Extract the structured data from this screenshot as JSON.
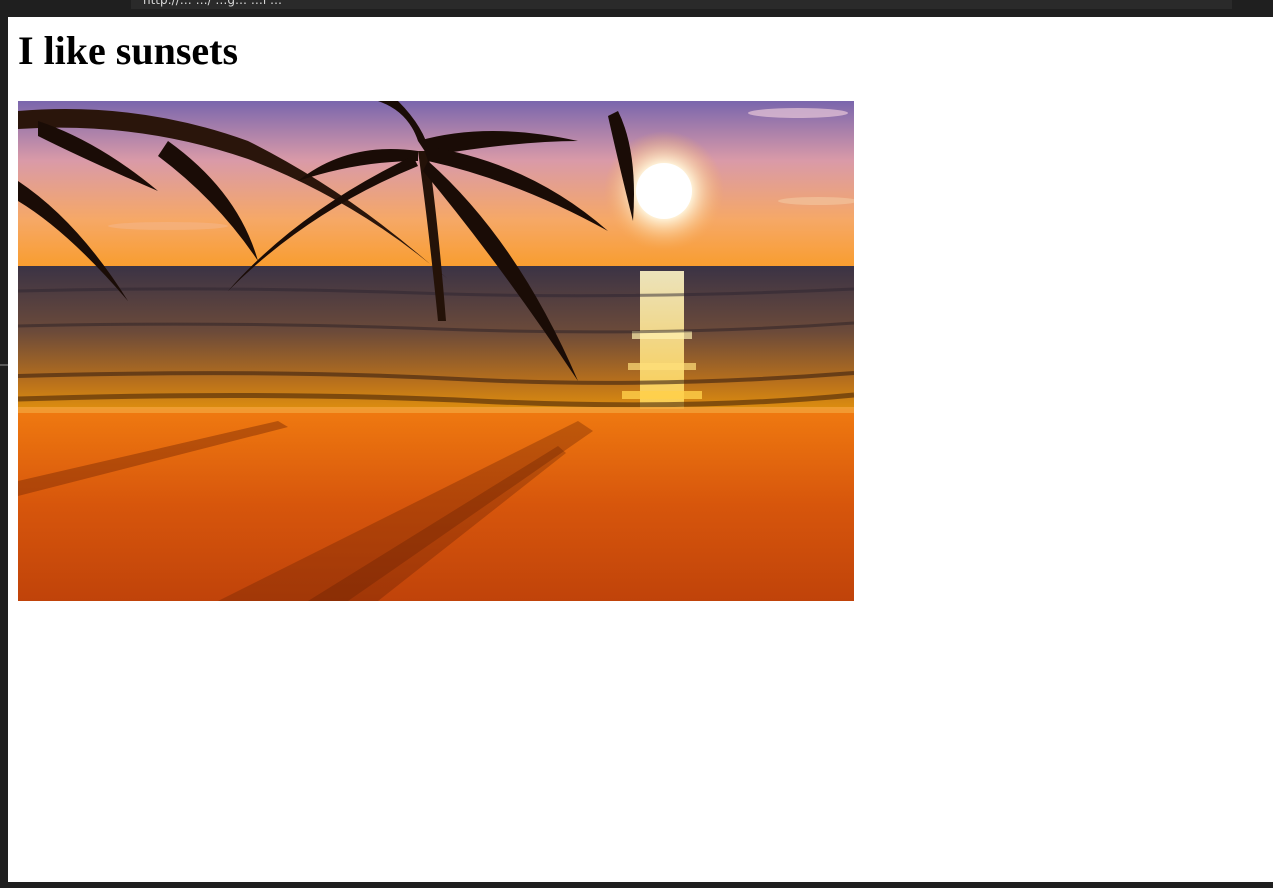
{
  "browser": {
    "address_bar_text": "http://…  …/ …g…  …l  …"
  },
  "page": {
    "heading": "I like sunsets"
  },
  "colors": {
    "chrome_background": "#1f1f1f",
    "page_background": "#ffffff",
    "heading_text": "#000000",
    "sky_top": "#8b6bb0",
    "sky_horizon": "#f7a43c",
    "sun": "#fffbe8",
    "sea": "#4a3a3a",
    "sand": "#d95a12"
  },
  "image": {
    "subject": "sunset-beach-palm-photo"
  }
}
